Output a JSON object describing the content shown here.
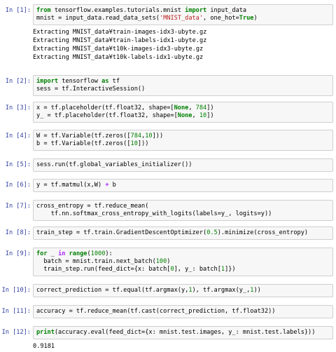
{
  "cells": [
    {
      "prompt": "In [1]:",
      "code": [
        [
          [
            "kw",
            "from"
          ],
          [
            "p",
            " tensorflow.examples.tutorials.mnist "
          ],
          [
            "kw",
            "import"
          ],
          [
            "p",
            " input_data"
          ]
        ],
        [
          [
            "p",
            "mnist = input_data.read_data_sets("
          ],
          [
            "str",
            "'MNIST_data'"
          ],
          [
            "p",
            ", one_hot="
          ],
          [
            "kw",
            "True"
          ],
          [
            "p",
            ")"
          ]
        ]
      ],
      "output": [
        "Extracting MNIST_data¥train-images-idx3-ubyte.gz",
        "Extracting MNIST_data¥train-labels-idx1-ubyte.gz",
        "Extracting MNIST_data¥t10k-images-idx3-ubyte.gz",
        "Extracting MNIST_data¥t10k-labels-idx1-ubyte.gz"
      ]
    },
    {
      "prompt": "In [2]:",
      "code": [
        [
          [
            "kw",
            "import"
          ],
          [
            "p",
            " tensorflow "
          ],
          [
            "kw",
            "as"
          ],
          [
            "p",
            " tf"
          ]
        ],
        [
          [
            "p",
            "sess = tf.InteractiveSession()"
          ]
        ]
      ],
      "output": []
    },
    {
      "prompt": "In [3]:",
      "code": [
        [
          [
            "p",
            "x = tf.placeholder(tf.float32, shape=["
          ],
          [
            "kw",
            "None"
          ],
          [
            "p",
            ", "
          ],
          [
            "num",
            "784"
          ],
          [
            "p",
            "])"
          ]
        ],
        [
          [
            "p",
            "y_ = tf.placeholder(tf.float32, shape=["
          ],
          [
            "kw",
            "None"
          ],
          [
            "p",
            ", "
          ],
          [
            "num",
            "10"
          ],
          [
            "p",
            "])"
          ]
        ]
      ],
      "output": []
    },
    {
      "prompt": "In [4]:",
      "code": [
        [
          [
            "p",
            "W = tf.Variable(tf.zeros(["
          ],
          [
            "num",
            "784"
          ],
          [
            "p",
            ","
          ],
          [
            "num",
            "10"
          ],
          [
            "p",
            "]))"
          ]
        ],
        [
          [
            "p",
            "b = tf.Variable(tf.zeros(["
          ],
          [
            "num",
            "10"
          ],
          [
            "p",
            "]))"
          ]
        ]
      ],
      "output": []
    },
    {
      "prompt": "In [5]:",
      "code": [
        [
          [
            "p",
            "sess.run(tf.global_variables_initializer())"
          ]
        ]
      ],
      "output": []
    },
    {
      "prompt": "In [6]:",
      "code": [
        [
          [
            "p",
            "y = tf.matmul(x,W) "
          ],
          [
            "op",
            "+"
          ],
          [
            "p",
            " b"
          ]
        ]
      ],
      "output": []
    },
    {
      "prompt": "In [7]:",
      "code": [
        [
          [
            "p",
            "cross_entropy = tf.reduce_mean("
          ]
        ],
        [
          [
            "p",
            "    tf.nn.softmax_cross_entropy_with_logits(labels=y_, logits=y))"
          ]
        ]
      ],
      "output": []
    },
    {
      "prompt": "In [8]:",
      "code": [
        [
          [
            "p",
            "train_step = tf.train.GradientDescentOptimizer("
          ],
          [
            "num",
            "0.5"
          ],
          [
            "p",
            ").minimize(cross_entropy)"
          ]
        ]
      ],
      "output": []
    },
    {
      "prompt": "In [9]:",
      "code": [
        [
          [
            "kw",
            "for"
          ],
          [
            "p",
            " _ "
          ],
          [
            "ow",
            "in"
          ],
          [
            "p",
            " "
          ],
          [
            "kw",
            "range"
          ],
          [
            "p",
            "("
          ],
          [
            "num",
            "1000"
          ],
          [
            "p",
            "):"
          ]
        ],
        [
          [
            "p",
            "  batch = mnist.train.next_batch("
          ],
          [
            "num",
            "100"
          ],
          [
            "p",
            ")"
          ]
        ],
        [
          [
            "p",
            "  train_step.run(feed_dict={x: batch["
          ],
          [
            "num",
            "0"
          ],
          [
            "p",
            "], y_: batch["
          ],
          [
            "num",
            "1"
          ],
          [
            "p",
            "]})"
          ]
        ]
      ],
      "output": []
    },
    {
      "prompt": "In [10]:",
      "code": [
        [
          [
            "p",
            "correct_prediction = tf.equal(tf.argmax(y,"
          ],
          [
            "num",
            "1"
          ],
          [
            "p",
            "), tf.argmax(y_,"
          ],
          [
            "num",
            "1"
          ],
          [
            "p",
            "))"
          ]
        ]
      ],
      "output": []
    },
    {
      "prompt": "In [11]:",
      "code": [
        [
          [
            "p",
            "accuracy = tf.reduce_mean(tf.cast(correct_prediction, tf.float32))"
          ]
        ]
      ],
      "output": []
    },
    {
      "prompt": "In [12]:",
      "code": [
        [
          [
            "kw",
            "print"
          ],
          [
            "p",
            "(accuracy.eval(feed_dict={x: mnist.test.images, y_: mnist.test.labels}))"
          ]
        ]
      ],
      "output": [
        "0.9181"
      ]
    }
  ],
  "colors": {
    "prompt": "#303f9f",
    "keyword": "#008000",
    "string": "#ba2121",
    "number": "#008000",
    "operator": "#aa22ff",
    "cell_background": "#f7f7f7",
    "cell_border": "#cfcfcf"
  }
}
